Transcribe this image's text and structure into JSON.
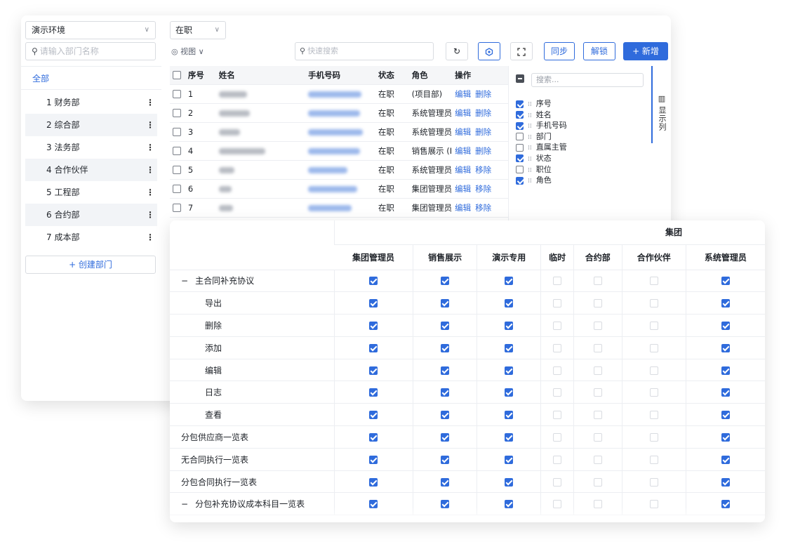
{
  "dept_panel": {
    "env_value": "演示环境",
    "search_placeholder": "请输入部门名称",
    "all_label": "全部",
    "items": [
      "1 财务部",
      "2 综合部",
      "3 法务部",
      "4 合作伙伴",
      "5 工程部",
      "6 合约部",
      "7 成本部"
    ],
    "create_label": "+ 创建部门"
  },
  "toolbar": {
    "status_value": "在职",
    "view_label": "视图",
    "search_placeholder": "快速搜索",
    "sync_label": "同步",
    "unlock_label": "解锁",
    "add_label": "+ 新增"
  },
  "user_table": {
    "headers": [
      "序号",
      "姓名",
      "手机号码",
      "状态",
      "角色",
      "操作"
    ],
    "rows": [
      {
        "no": "1",
        "status": "在职",
        "role": "(项目部)",
        "actions": [
          "编辑",
          "删除"
        ]
      },
      {
        "no": "2",
        "status": "在职",
        "role": "系统管理员",
        "actions": [
          "编辑",
          "删除"
        ]
      },
      {
        "no": "3",
        "status": "在职",
        "role": "系统管理员",
        "actions": [
          "编辑",
          "删除"
        ]
      },
      {
        "no": "4",
        "status": "在职",
        "role": "销售展示 (I",
        "actions": [
          "编辑",
          "删除"
        ]
      },
      {
        "no": "5",
        "status": "在职",
        "role": "系统管理员",
        "actions": [
          "编辑",
          "移除"
        ]
      },
      {
        "no": "6",
        "status": "在职",
        "role": "集团管理员",
        "actions": [
          "编辑",
          "移除"
        ]
      },
      {
        "no": "7",
        "status": "在职",
        "role": "集团管理员",
        "actions": [
          "编辑",
          "移除"
        ]
      }
    ]
  },
  "column_chooser": {
    "search_placeholder": "搜索...",
    "toggle_label": "显示列",
    "columns": [
      {
        "label": "序号",
        "checked": true
      },
      {
        "label": "姓名",
        "checked": true
      },
      {
        "label": "手机号码",
        "checked": true
      },
      {
        "label": "部门",
        "checked": false
      },
      {
        "label": "直属主管",
        "checked": false
      },
      {
        "label": "状态",
        "checked": true
      },
      {
        "label": "职位",
        "checked": false
      },
      {
        "label": "角色",
        "checked": true
      }
    ]
  },
  "permissions": {
    "group_label": "集团",
    "columns": [
      "集团管理员",
      "销售展示",
      "演示专用",
      "临时",
      "合约部",
      "合作伙伴",
      "系统管理员"
    ],
    "rows": [
      {
        "label": "主合同补充协议",
        "collapsible": true,
        "level": 0,
        "values": [
          1,
          1,
          1,
          0,
          0,
          0,
          1
        ]
      },
      {
        "label": "导出",
        "level": 1,
        "values": [
          1,
          1,
          1,
          0,
          0,
          0,
          1
        ]
      },
      {
        "label": "删除",
        "level": 1,
        "values": [
          1,
          1,
          1,
          0,
          0,
          0,
          1
        ]
      },
      {
        "label": "添加",
        "level": 1,
        "values": [
          1,
          1,
          1,
          0,
          0,
          0,
          1
        ]
      },
      {
        "label": "编辑",
        "level": 1,
        "values": [
          1,
          1,
          1,
          0,
          0,
          0,
          1
        ]
      },
      {
        "label": "日志",
        "level": 1,
        "values": [
          1,
          1,
          1,
          0,
          0,
          0,
          1
        ]
      },
      {
        "label": "查看",
        "level": 1,
        "values": [
          1,
          1,
          1,
          0,
          0,
          0,
          1
        ]
      },
      {
        "label": "分包供应商一览表",
        "level": 0,
        "values": [
          1,
          1,
          1,
          0,
          0,
          0,
          1
        ]
      },
      {
        "label": "无合同执行一览表",
        "level": 0,
        "values": [
          1,
          1,
          1,
          0,
          0,
          0,
          1
        ]
      },
      {
        "label": "分包合同执行一览表",
        "level": 0,
        "values": [
          1,
          1,
          1,
          0,
          0,
          0,
          1
        ]
      },
      {
        "label": "分包补充协议成本科目一览表",
        "collapsible": true,
        "level": 0,
        "values": [
          1,
          1,
          1,
          0,
          0,
          0,
          1
        ]
      }
    ]
  },
  "colors": {
    "accent": "#2f6bdc"
  }
}
